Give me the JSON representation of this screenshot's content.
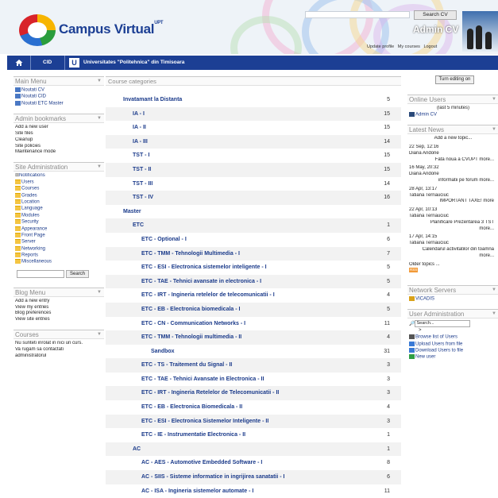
{
  "header": {
    "site_title": "Campus Virtual",
    "site_title_sup": "UPT",
    "search_button": "Search CV",
    "user_name": "Admin CV",
    "user_links": [
      "Update profile",
      "My courses",
      "Logout"
    ]
  },
  "nav": {
    "items": [
      "CID",
      "Universitates \"Politehnica\" din Timisoara"
    ]
  },
  "left": {
    "main_menu": {
      "title": "Main Menu",
      "items": [
        "Noutati CV",
        "Noutati CID",
        "Noutati ETC Master"
      ]
    },
    "admin_bookmarks": {
      "title": "Admin bookmarks",
      "items": [
        "Add a new user",
        "Site files",
        "Cleanup",
        "Site policies",
        "Maintenance mode"
      ]
    },
    "site_admin": {
      "title": "Site Administration",
      "items": [
        "Notifications",
        "Users",
        "Courses",
        "Grades",
        "Location",
        "Language",
        "Modules",
        "Security",
        "Appearance",
        "Front Page",
        "Server",
        "Networking",
        "Reports",
        "Miscellaneous"
      ],
      "search_button": "Search"
    },
    "blog_menu": {
      "title": "Blog Menu",
      "items": [
        "Add a new entry",
        "View my entries",
        "Blog preferences",
        "View site entries"
      ]
    },
    "courses": {
      "title": "Courses",
      "text": [
        "Nu sunteti inrolat in nici un curs.",
        "Va rugam sa contactati",
        "administratorul"
      ]
    }
  },
  "main": {
    "title": "Course categories",
    "edit_button": "Turn editing on",
    "categories": [
      {
        "name": "Invatamant la Distanta",
        "count": "5",
        "level": 0
      },
      {
        "name": "IA - I",
        "count": "15",
        "level": 1
      },
      {
        "name": "IA - II",
        "count": "15",
        "level": 1
      },
      {
        "name": "IA - III",
        "count": "14",
        "level": 1
      },
      {
        "name": "TST - I",
        "count": "15",
        "level": 1
      },
      {
        "name": "TST - II",
        "count": "15",
        "level": 1
      },
      {
        "name": "TST - III",
        "count": "14",
        "level": 1
      },
      {
        "name": "TST - IV",
        "count": "16",
        "level": 1
      },
      {
        "name": "Master",
        "count": "",
        "level": 0
      },
      {
        "name": "ETC",
        "count": "1",
        "level": 1
      },
      {
        "name": "ETC - Optional - I",
        "count": "6",
        "level": 2
      },
      {
        "name": "ETC - TMM - Tehnologii Multimedia - I",
        "count": "7",
        "level": 2
      },
      {
        "name": "ETC - ESI - Electronica sistemelor inteligente - I",
        "count": "5",
        "level": 2
      },
      {
        "name": "ETC - TAE - Tehnici avansate in electronica - I",
        "count": "5",
        "level": 2
      },
      {
        "name": "ETC - IRT - Ingineria retelelor de telecomunicatii - I",
        "count": "4",
        "level": 2
      },
      {
        "name": "ETC - EB - Electronica biomedicala - I",
        "count": "5",
        "level": 2
      },
      {
        "name": "ETC - CN - Communication Networks - I",
        "count": "11",
        "level": 2
      },
      {
        "name": "ETC - TMM - Tehnologii multimedia - II",
        "count": "4",
        "level": 2
      },
      {
        "name": "Sandbox",
        "count": "31",
        "level": 3
      },
      {
        "name": "ETC - TS - Traitement du Signal - II",
        "count": "3",
        "level": 2
      },
      {
        "name": "ETC - TAE - Tehnici Avansate in Electronica - II",
        "count": "3",
        "level": 2
      },
      {
        "name": "ETC - IRT - Ingineria Retelelor de Telecomunicatii - II",
        "count": "3",
        "level": 2
      },
      {
        "name": "ETC - EB - Electronica Biomedicala - II",
        "count": "4",
        "level": 2
      },
      {
        "name": "ETC - ESI - Electronica Sistemelor Inteligente - II",
        "count": "3",
        "level": 2
      },
      {
        "name": "ETC - IE - Instrumentatie Electronica - II",
        "count": "1",
        "level": 2
      },
      {
        "name": "AC",
        "count": "1",
        "level": 1
      },
      {
        "name": "AC - AES - Automotive Embedded Software - I",
        "count": "8",
        "level": 2
      },
      {
        "name": "AC - SIIS - Sisteme informatice in ingrijirea sanatatii - I",
        "count": "6",
        "level": 2
      },
      {
        "name": "AC - ISA - Ingineria sistemelor automate - I",
        "count": "11",
        "level": 2
      }
    ]
  },
  "right": {
    "online": {
      "title": "Online Users",
      "note": "(last 5 minutes)",
      "user": "Admin CV"
    },
    "news": {
      "title": "Latest News",
      "add": "Add a new topic...",
      "items": [
        {
          "date": "22 Sep, 12:16",
          "author": "Diana Andone",
          "text": "Fata noua a CVUPT more..."
        },
        {
          "date": "16 May, 20:32",
          "author": "Diana Andone",
          "text": "informatii pe forum more..."
        },
        {
          "date": "28 Apr, 13:17",
          "author": "Tatiana Ternauciuc",
          "text": "IMPORTANT TAXE! more"
        },
        {
          "date": "22 Apr, 10:13",
          "author": "Tatiana Ternauciuc",
          "text": "Planificare Prezentarea 3 TST",
          "more": "more..."
        },
        {
          "date": "17 Apr, 14:15",
          "author": "Tatiana Ternauciuc",
          "text": "Calendarul activitatilor din toamna",
          "more": "more..."
        }
      ],
      "older": "Older topics ...",
      "rss": "RSS"
    },
    "network": {
      "title": "Network Servers",
      "item": "VICADIS"
    },
    "user_admin": {
      "title": "User Administration",
      "search": "Search...",
      "items": [
        "Browse list of Users",
        "Upload Users from file",
        "Download Users to file",
        "New user"
      ]
    }
  },
  "colors": {
    "nav_bg": "#1c3f94",
    "link": "#1a3a8a",
    "header_bg": "#eef3f8"
  }
}
